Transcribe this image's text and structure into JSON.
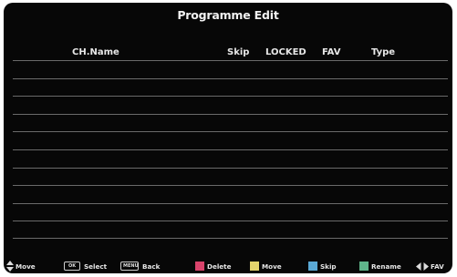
{
  "title": "Programme Edit",
  "columns": {
    "name": "CH.Name",
    "skip": "Skip",
    "locked": "LOCKED",
    "fav": "FAV",
    "type": "Type"
  },
  "row_count": 10,
  "footer": {
    "move": "Move",
    "select": "Select",
    "select_key": "OK",
    "back": "Back",
    "back_key": "MENU",
    "delete": "Delete",
    "move2": "Move",
    "skip": "Skip",
    "rename": "Rename",
    "fav": "FAV"
  },
  "colors": {
    "red": "#d9436b",
    "yellow": "#e3d36c",
    "blue": "#5aa9d6",
    "green": "#5fb58a"
  }
}
